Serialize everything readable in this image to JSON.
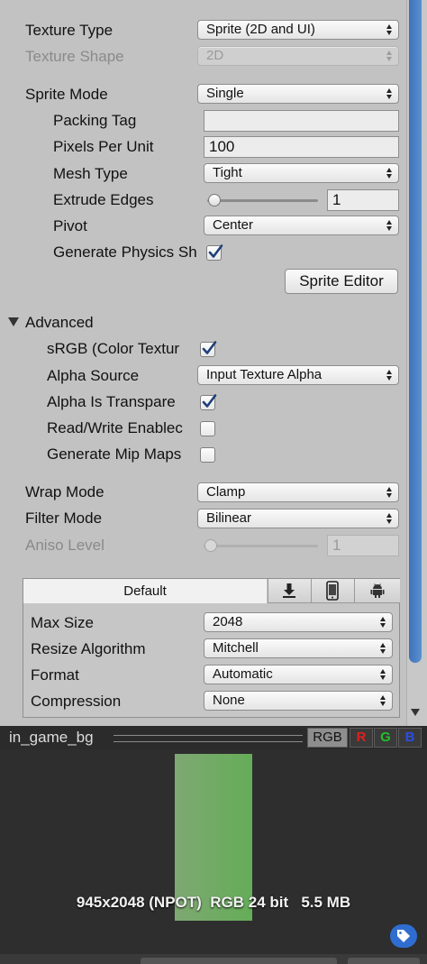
{
  "texture_type": {
    "label": "Texture Type",
    "value": "Sprite (2D and UI)"
  },
  "texture_shape": {
    "label": "Texture Shape",
    "value": "2D"
  },
  "sprite_mode": {
    "label": "Sprite Mode",
    "value": "Single"
  },
  "packing_tag": {
    "label": "Packing Tag",
    "value": ""
  },
  "pixels_per_unit": {
    "label": "Pixels Per Unit",
    "value": "100"
  },
  "mesh_type": {
    "label": "Mesh Type",
    "value": "Tight"
  },
  "extrude_edges": {
    "label": "Extrude Edges",
    "value": "1",
    "slider_fraction": 0.03
  },
  "pivot": {
    "label": "Pivot",
    "value": "Center"
  },
  "generate_physics_shape": {
    "label": "Generate Physics Sh",
    "checked": true
  },
  "sprite_editor_button": "Sprite Editor",
  "advanced": {
    "label": "Advanced",
    "expanded": true
  },
  "srgb": {
    "label": "sRGB (Color Textur",
    "checked": true
  },
  "alpha_source": {
    "label": "Alpha Source",
    "value": "Input Texture Alpha"
  },
  "alpha_is_transparency": {
    "label": "Alpha Is Transpare",
    "checked": true
  },
  "read_write": {
    "label": "Read/Write Enablec",
    "checked": false
  },
  "generate_mip_maps": {
    "label": "Generate Mip Maps",
    "checked": false
  },
  "wrap_mode": {
    "label": "Wrap Mode",
    "value": "Clamp"
  },
  "filter_mode": {
    "label": "Filter Mode",
    "value": "Bilinear"
  },
  "aniso_level": {
    "label": "Aniso Level",
    "value": "1",
    "slider_fraction": 0.03
  },
  "platform_tabs": {
    "default_label": "Default",
    "icons": [
      "download-icon",
      "mobile-device-icon",
      "android-icon"
    ]
  },
  "max_size": {
    "label": "Max Size",
    "value": "2048"
  },
  "resize_algorithm": {
    "label": "Resize Algorithm",
    "value": "Mitchell"
  },
  "format": {
    "label": "Format",
    "value": "Automatic"
  },
  "compression": {
    "label": "Compression",
    "value": "None"
  },
  "preview": {
    "title": "in_game_bg",
    "channels": [
      "RGB",
      "R",
      "G",
      "B"
    ],
    "channel_colors": {
      "R": "#e02020",
      "G": "#22c02a",
      "B": "#2a4de6"
    },
    "info": "945x2048 (NPOT)  RGB 24 bit   5.5 MB",
    "texture_color": "#6fae5d"
  },
  "colors": {
    "panel_bg": "#c2c2c2",
    "preview_bg": "#2e2e2e",
    "scrollbar": "#4a7fc0"
  }
}
